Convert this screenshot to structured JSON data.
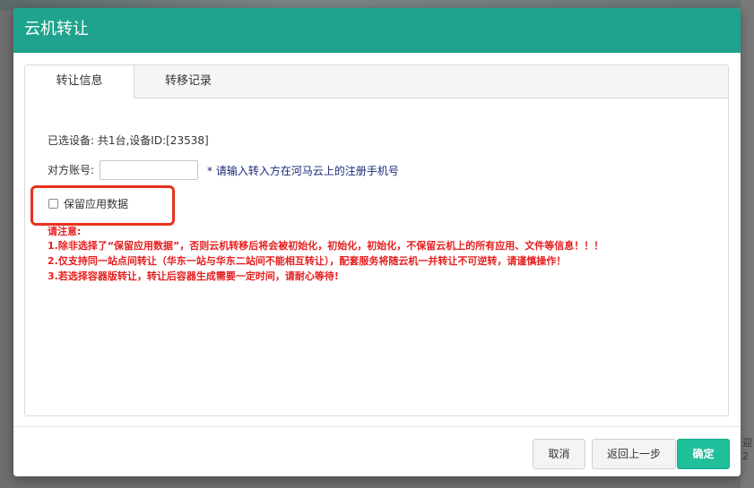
{
  "dialog": {
    "title": "云机转让"
  },
  "tabs": [
    {
      "label": "转让信息",
      "active": true
    },
    {
      "label": "转移记录",
      "active": false
    }
  ],
  "transfer": {
    "selected_devices": "已选设备: 共1台,设备ID:[23538]",
    "account_label": "对方账号:",
    "account_value": "",
    "account_placeholder": "",
    "account_hint": "* 请输入转入方在河马云上的注册手机号",
    "keep_data_label": "保留应用数据",
    "keep_data_checked": false
  },
  "notice": {
    "title": "请注意:",
    "lines": [
      "1.除非选择了“保留应用数据”，否则云机转移后将会被初始化，初始化，初始化，不保留云机上的所有应用、文件等信息！！！",
      "2.仅支持同一站点间转让（华东一站与华东二站间不能相互转让），配套服务将随云机一并转让不可逆转，请谨慎操作！",
      "3.若选择容器版转让，转让后容器生成需要一定时间，请耐心等待!"
    ]
  },
  "buttons": {
    "cancel": "取消",
    "back": "返回上一步",
    "confirm": "确定"
  },
  "colors": {
    "header": "#1fa38e",
    "confirm": "#1fbf9c",
    "warning_text": "#e61e1e",
    "highlight_box": "#e8321e",
    "hint_text": "#1a2a7a"
  },
  "backdrop": {
    "right_fragment_1": "迎",
    "right_fragment_2": "2"
  }
}
